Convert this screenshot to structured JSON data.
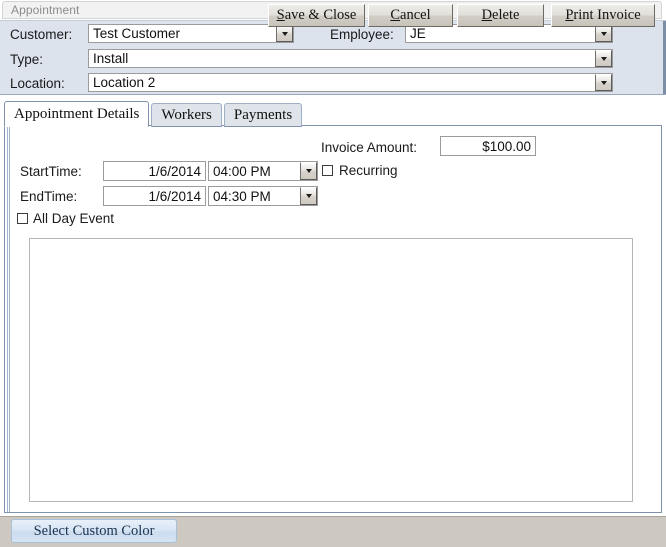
{
  "window": {
    "title": "Appointment"
  },
  "header": {
    "customer": {
      "label": "Customer:",
      "value": "Test Customer",
      "dropdown_icon": "chevron-down-icon"
    },
    "employee": {
      "label": "Employee:",
      "value": "JE",
      "dropdown_icon": "chevron-down-icon"
    },
    "type": {
      "label": "Type:",
      "value": "Install",
      "dropdown_icon": "chevron-down-icon"
    },
    "location": {
      "label": "Location:",
      "value": "Location 2",
      "dropdown_icon": "chevron-down-icon"
    }
  },
  "tabs": [
    {
      "label": "Appointment Details",
      "active": true
    },
    {
      "label": "Workers",
      "active": false
    },
    {
      "label": "Payments",
      "active": false
    }
  ],
  "details": {
    "invoice_amount": {
      "label": "Invoice Amount:",
      "value": "$100.00"
    },
    "start_time": {
      "label": "StartTime:",
      "date": "1/6/2014",
      "time": "04:00 PM",
      "dropdown_icon": "chevron-down-icon"
    },
    "end_time": {
      "label": "EndTime:",
      "date": "1/6/2014",
      "time": "04:30 PM",
      "dropdown_icon": "chevron-down-icon"
    },
    "recurring": {
      "label": "Recurring",
      "checked": false
    },
    "all_day_event": {
      "label": "All Day Event",
      "checked": false
    },
    "notes": {
      "value": ""
    }
  },
  "footer": {
    "select_custom_color": "Select Custom Color",
    "save_close": {
      "accel": "S",
      "rest": "ave & Close"
    },
    "cancel": {
      "accel": "C",
      "rest": "ancel"
    },
    "delete": {
      "accel": "D",
      "rest": "elete"
    },
    "print_invoice": {
      "accel": "P",
      "rest": "rint Invoice"
    }
  },
  "colors": {
    "header_bg": "#dce3ed",
    "tab_active_bg": "#ffffff",
    "tab_inactive_bg": "#dfe4ea",
    "panel_border": "#7e93ab",
    "footer_bg": "#cdc9c1",
    "custom_color_btn": "#d9e6f4"
  }
}
